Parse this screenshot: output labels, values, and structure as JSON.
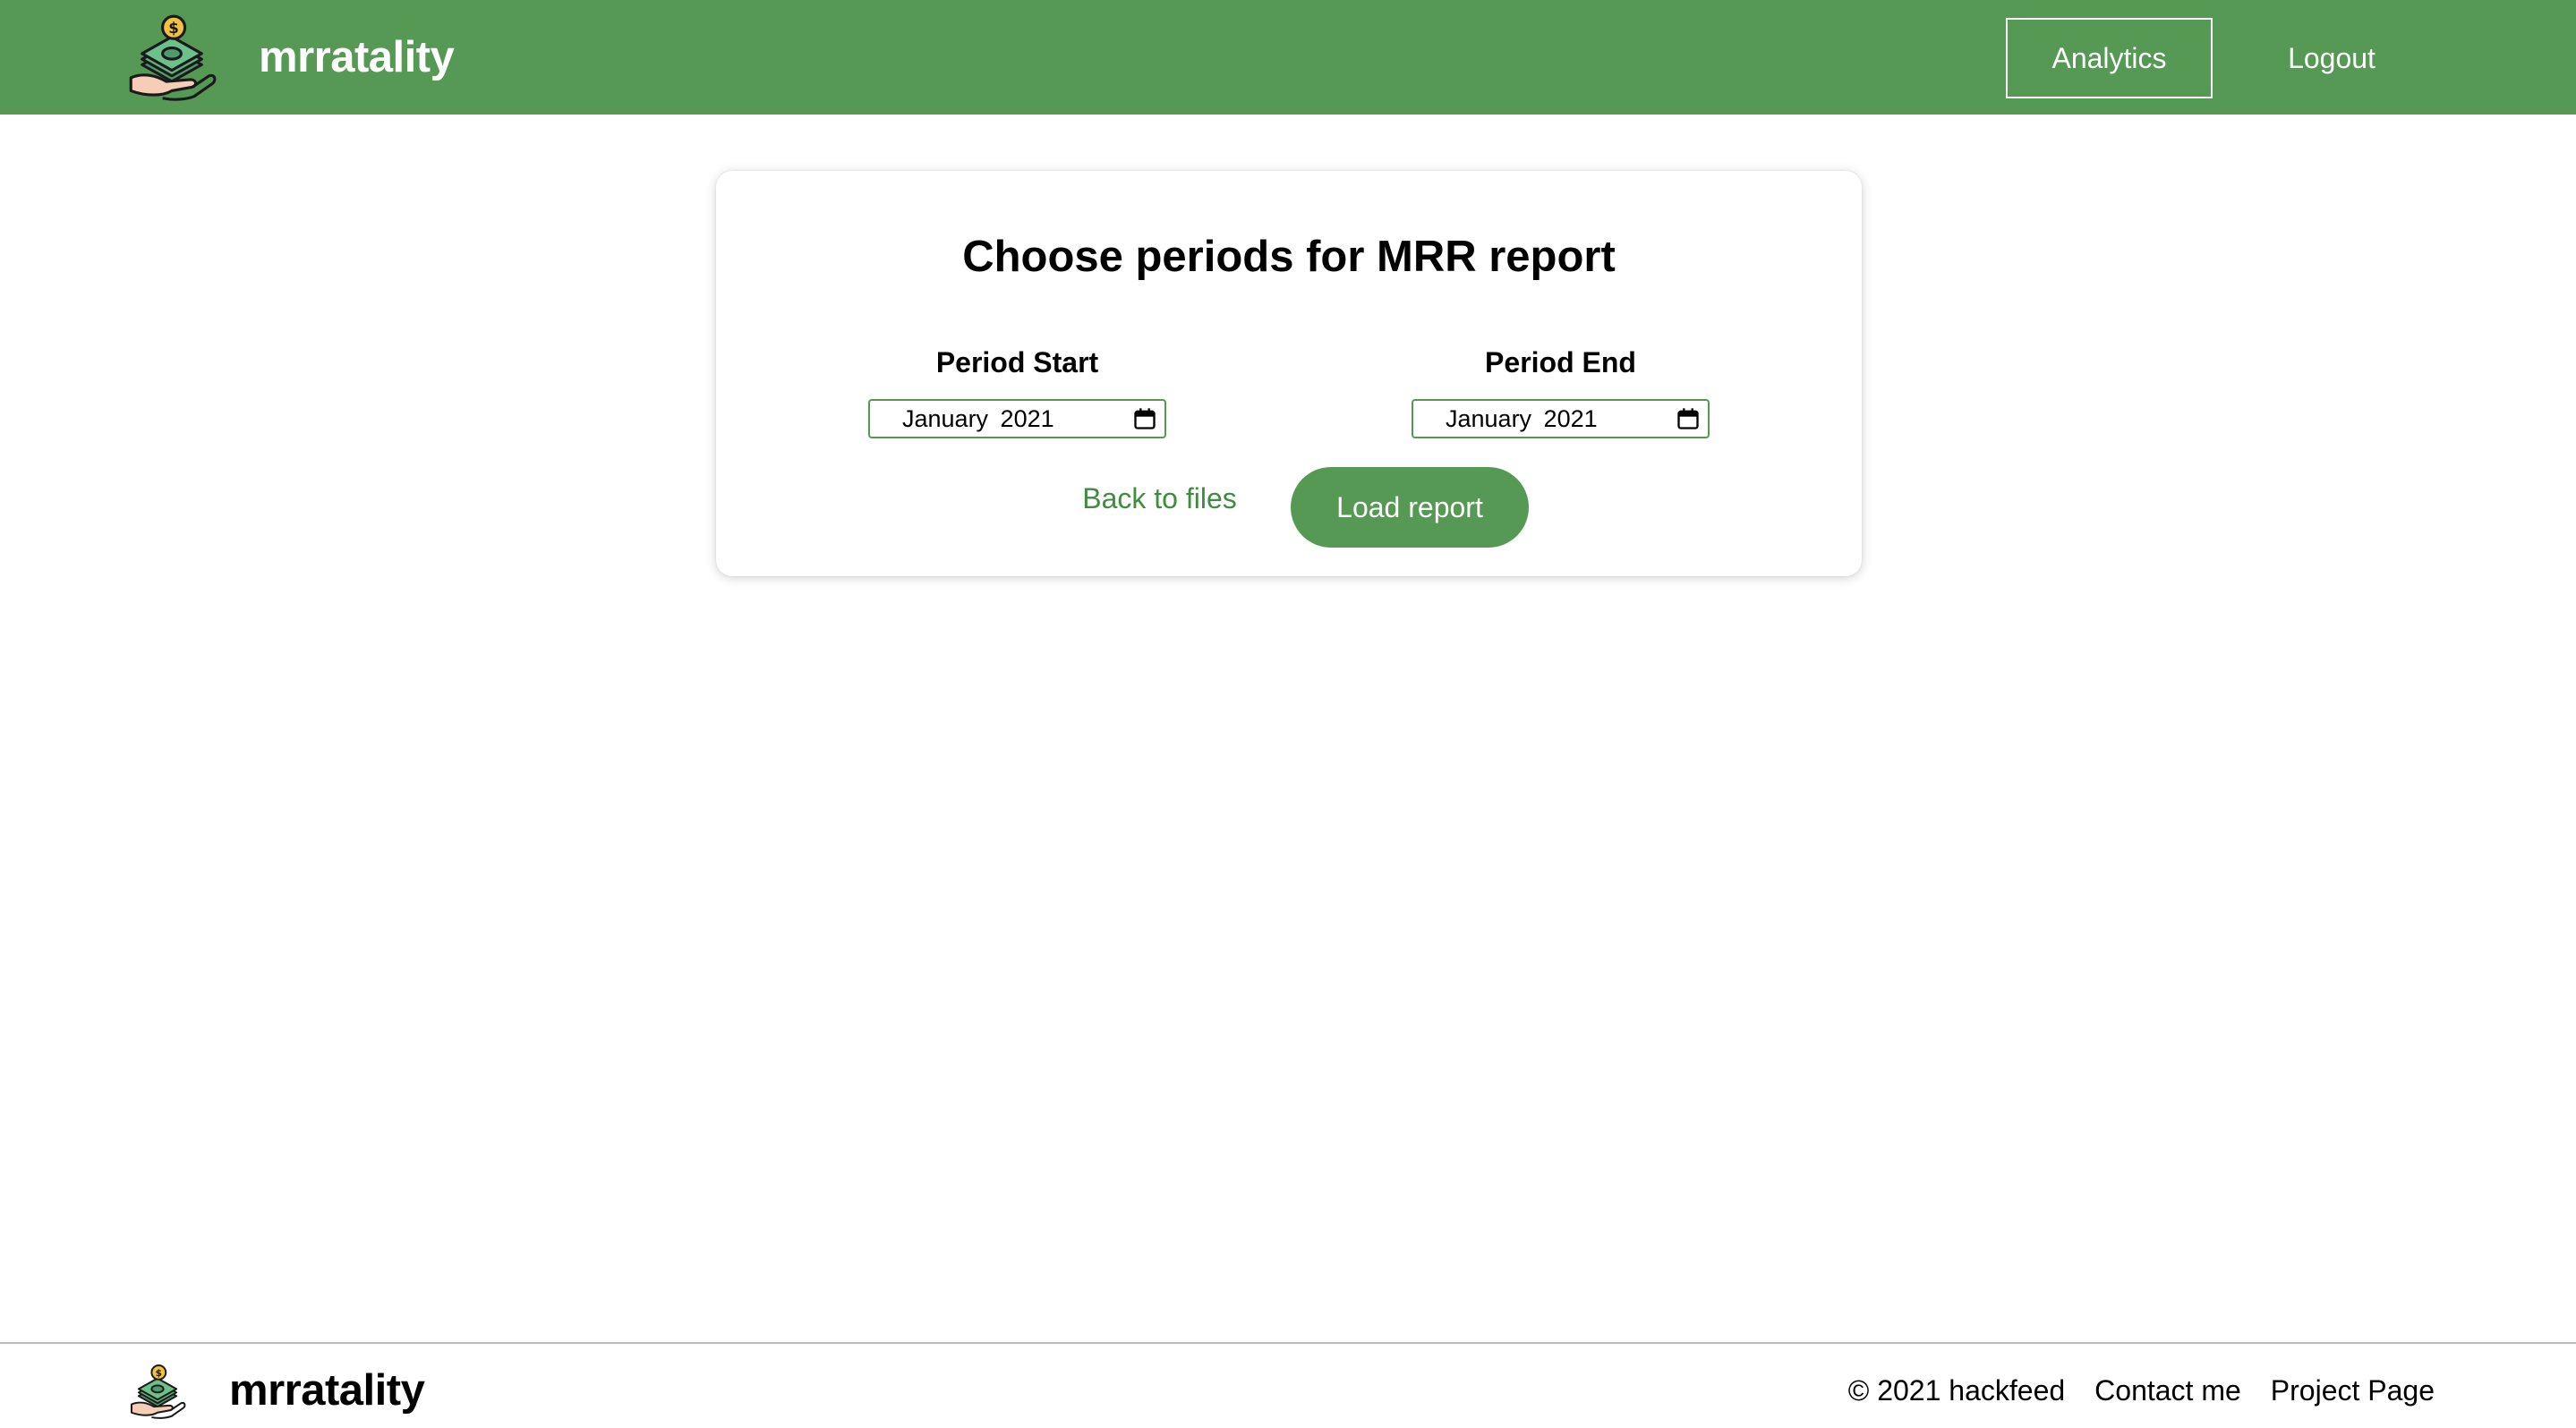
{
  "header": {
    "brand": "mrratality",
    "logo_icon": "money-hand-icon",
    "nav": {
      "analytics_label": "Analytics",
      "logout_label": "Logout"
    }
  },
  "card": {
    "title": "Choose periods for MRR report",
    "period_start": {
      "label": "Period Start",
      "value": "January 2021"
    },
    "period_end": {
      "label": "Period End",
      "value": "January 2021"
    },
    "back_label": "Back to files",
    "load_label": "Load report"
  },
  "footer": {
    "brand": "mrratality",
    "logo_icon": "money-hand-icon",
    "copyright": "© 2021 hackfeed",
    "contact_label": "Contact me",
    "project_label": "Project Page"
  },
  "colors": {
    "brand_green": "#559955",
    "link_green": "#3f8c3f",
    "background": "#ffffff"
  }
}
